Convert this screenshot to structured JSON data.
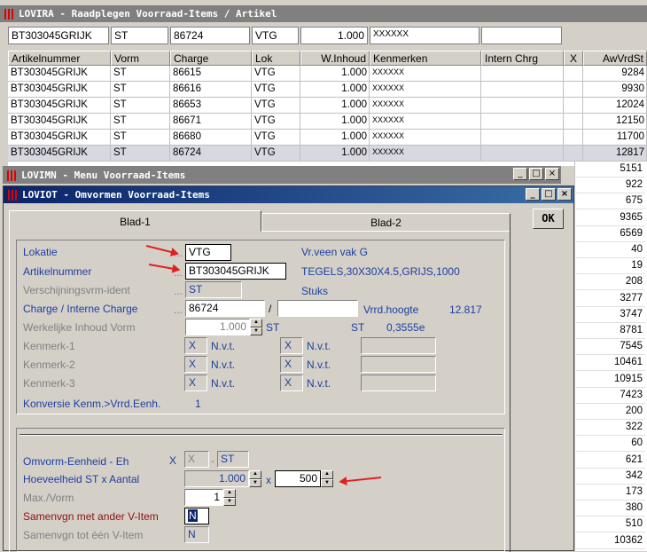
{
  "main_window": {
    "title": "LOVIRA - Raadplegen Voorraad-Items / Artikel",
    "filter": {
      "artikel": "BT303045GRIJK",
      "vorm": "ST",
      "charge": "86724",
      "lok": "VTG",
      "inhoud": "1.000",
      "kenmerken": "XXXXXX",
      "intern": ""
    },
    "columns": [
      "Artikelnummer",
      "Vorm",
      "Charge",
      "Lok",
      "W.Inhoud",
      "Kenmerken",
      "Intern Chrg",
      "X",
      "AwVrdSt"
    ],
    "rows": [
      [
        "BT303045GRIJK",
        "ST",
        "86615",
        "VTG",
        "1.000",
        "XXXXXX",
        "",
        "",
        "9284"
      ],
      [
        "BT303045GRIJK",
        "ST",
        "86616",
        "VTG",
        "1.000",
        "XXXXXX",
        "",
        "",
        "9930"
      ],
      [
        "BT303045GRIJK",
        "ST",
        "86653",
        "VTG",
        "1.000",
        "XXXXXX",
        "",
        "",
        "12024"
      ],
      [
        "BT303045GRIJK",
        "ST",
        "86671",
        "VTG",
        "1.000",
        "XXXXXX",
        "",
        "",
        "12150"
      ],
      [
        "BT303045GRIJK",
        "ST",
        "86680",
        "VTG",
        "1.000",
        "XXXXXX",
        "",
        "",
        "11700"
      ],
      [
        "BT303045GRIJK",
        "ST",
        "86724",
        "VTG",
        "1.000",
        "XXXXXX",
        "",
        "",
        "12817"
      ]
    ],
    "right_column_values": [
      "5151",
      "922",
      "675",
      "9365",
      "6569",
      "40",
      "19",
      "208",
      "3277",
      "3747",
      "8781",
      "7545",
      "10461",
      "10915",
      "7423",
      "200",
      "322",
      "60",
      "621",
      "342",
      "173",
      "380",
      "510",
      "10362"
    ]
  },
  "menu_window": {
    "title": "LOVIMN - Menu Voorraad-Items"
  },
  "dialog": {
    "title": "LOVIOT - Omvormen Voorraad-Items",
    "tabs": [
      "Blad-1",
      "Blad-2"
    ],
    "ok_label": "OK",
    "dots": "...",
    "lokatie": {
      "label": "Lokatie",
      "value": "VTG",
      "desc": "Vr.veen vak G"
    },
    "artikel": {
      "label": "Artikelnummer",
      "value": "BT303045GRIJK",
      "desc": "TEGELS,30X30X4.5,GRIJS,1000"
    },
    "verschijning": {
      "label": "Verschijningsvrm-ident",
      "value": "ST",
      "desc": "Stuks"
    },
    "charge": {
      "label": "Charge / Interne Charge",
      "value": "86724",
      "sep": "/",
      "intern": "",
      "vrrd_label": "Vrrd.hoogte",
      "vrrd_value": "12.817"
    },
    "werkelijke": {
      "label": "Werkelijke Inhoud Vorm",
      "value": "1.000",
      "unit": "ST",
      "unit2": "ST",
      "value2": "0,3555e"
    },
    "kenmerken": [
      {
        "label": "Kenmerk-1",
        "x1": "X",
        "n1": "N.v.t.",
        "x2": "X",
        "n2": "N.v.t."
      },
      {
        "label": "Kenmerk-2",
        "x1": "X",
        "n1": "N.v.t.",
        "x2": "X",
        "n2": "N.v.t."
      },
      {
        "label": "Kenmerk-3",
        "x1": "X",
        "n1": "N.v.t.",
        "x2": "X",
        "n2": "N.v.t."
      }
    ],
    "konversie": {
      "label": "Konversie Kenm.>Vrrd.Eenh.",
      "value": "1"
    },
    "omvorm": {
      "label": "Omvorm-Eenheid - Eh",
      "x_label": "X",
      "x_value": "X",
      "sep": "-",
      "unit": "ST"
    },
    "hoeveelheid": {
      "label": "Hoeveelheid ST x Aantal",
      "value": "1.000",
      "times": "x",
      "aantal": "500"
    },
    "max_vorm": {
      "label": "Max./Vorm",
      "value": "1"
    },
    "samenvgn": {
      "label": "Samenvgn met ander V-Item",
      "value": "N"
    },
    "samenvgn_een": {
      "label": "Samenvgn tot één V-Item",
      "value": "N"
    }
  }
}
